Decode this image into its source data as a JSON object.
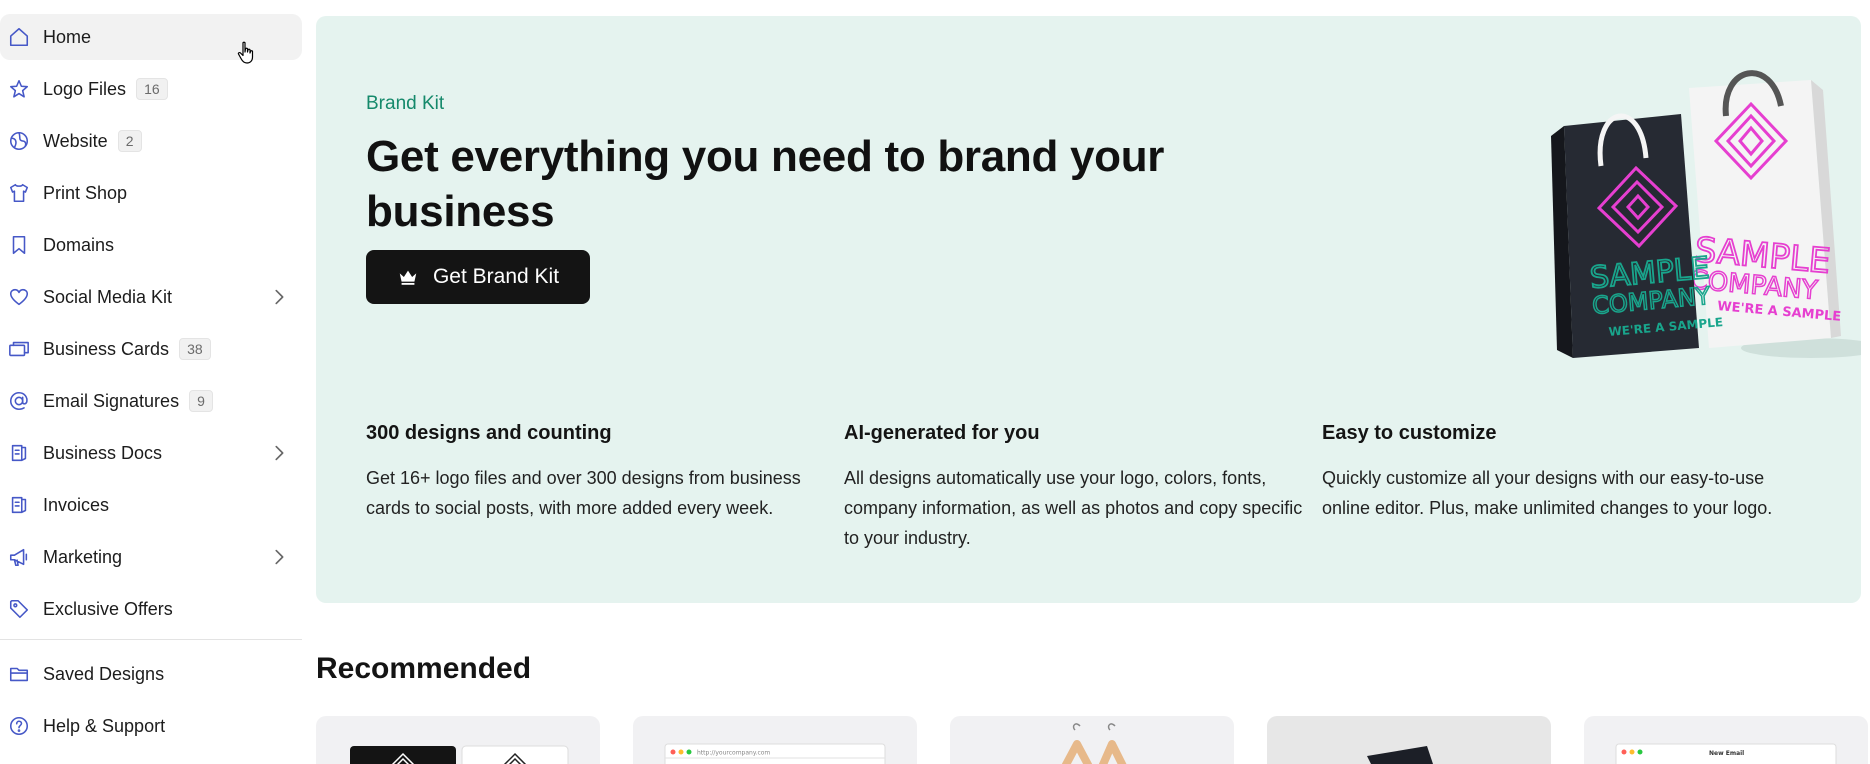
{
  "sidebar": {
    "items": [
      {
        "label": "Home",
        "icon": "home-icon",
        "count": null,
        "chevron": false,
        "active": true
      },
      {
        "label": "Logo Files",
        "icon": "star-icon",
        "count": "16",
        "chevron": false
      },
      {
        "label": "Website",
        "icon": "globe-icon",
        "count": "2",
        "chevron": false
      },
      {
        "label": "Print Shop",
        "icon": "shirt-icon",
        "count": null,
        "chevron": false
      },
      {
        "label": "Domains",
        "icon": "bookmark-icon",
        "count": null,
        "chevron": false
      },
      {
        "label": "Social Media Kit",
        "icon": "heart-icon",
        "count": null,
        "chevron": true
      },
      {
        "label": "Business Cards",
        "icon": "cards-icon",
        "count": "38",
        "chevron": false
      },
      {
        "label": "Email Signatures",
        "icon": "at-icon",
        "count": "9",
        "chevron": false
      },
      {
        "label": "Business Docs",
        "icon": "document-icon",
        "count": null,
        "chevron": true
      },
      {
        "label": "Invoices",
        "icon": "invoice-icon",
        "count": null,
        "chevron": false
      },
      {
        "label": "Marketing",
        "icon": "megaphone-icon",
        "count": null,
        "chevron": true
      },
      {
        "label": "Exclusive Offers",
        "icon": "tag-icon",
        "count": null,
        "chevron": false
      }
    ],
    "bottom_items": [
      {
        "label": "Saved Designs",
        "icon": "folder-icon"
      },
      {
        "label": "Help & Support",
        "icon": "help-icon"
      }
    ]
  },
  "hero": {
    "eyebrow": "Brand Kit",
    "title": "Get everything you need to brand your business",
    "cta_label": "Get Brand Kit",
    "features": [
      {
        "title": "300 designs and counting",
        "desc": "Get 16+ logo files and over 300 designs from business cards to social posts, with more added every week."
      },
      {
        "title": "AI-generated for you",
        "desc": "All designs automatically use your logo, colors, fonts, company information, as well as photos and copy specific to your industry."
      },
      {
        "title": "Easy to customize",
        "desc": "Quickly customize all your designs with our easy-to-use online editor. Plus, make unlimited changes to your logo."
      }
    ],
    "bag_dark": {
      "line1": "SAMPLE",
      "line2": "COMPANY",
      "line3": "WE'RE A SAMPLE"
    },
    "bag_light": {
      "line1": "SAMPLE",
      "line2": "COMPANY",
      "line3": "WE'RE A SAMPLE"
    }
  },
  "recommended": {
    "title": "Recommended",
    "card_url_text": "http://yourcompany.com",
    "card_email_text": "New Email"
  },
  "colors": {
    "accent": "#4658c7",
    "hero_bg": "#e5f3ef",
    "eyebrow": "#15896b",
    "cta_bg": "#141414",
    "teal_logo": "#19a58c",
    "pink_logo": "#e63fd0"
  }
}
